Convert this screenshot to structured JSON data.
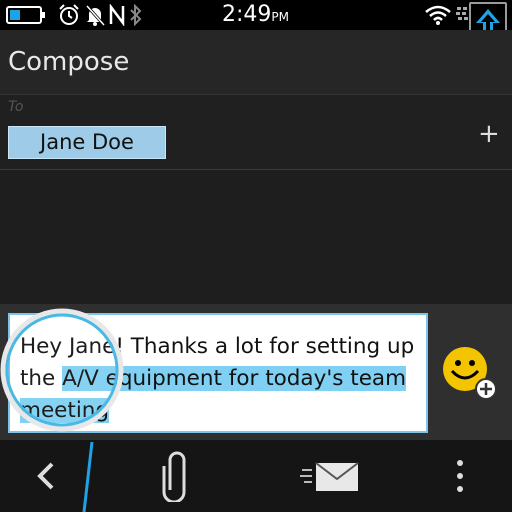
{
  "status_bar": {
    "time": "2:49",
    "ampm": "PM",
    "icons": [
      "battery-icon",
      "alarm-icon",
      "notifications-muted-icon",
      "nfc-icon",
      "bluetooth-icon",
      "wifi-icon",
      "blackberry-icon",
      "share-icon"
    ]
  },
  "header": {
    "title": "Compose"
  },
  "recipient": {
    "to_label": "To",
    "chips": [
      "Jane Doe"
    ],
    "add_label": "+"
  },
  "message": {
    "prefix": "Hey Jane! Thanks a lot for setting up\nthe ",
    "selected": "A/V equipment for today's team\nmeeting",
    "suffix": ""
  },
  "toolbar": {
    "back_icon": "chevron-left-icon",
    "attach_icon": "paperclip-icon",
    "send_icon": "envelope-send-icon",
    "overflow_icon": "overflow-dots-icon"
  },
  "colors": {
    "accent": "#1fa3e6",
    "selection": "#7fd0f2",
    "chip": "#9dcbe8"
  }
}
